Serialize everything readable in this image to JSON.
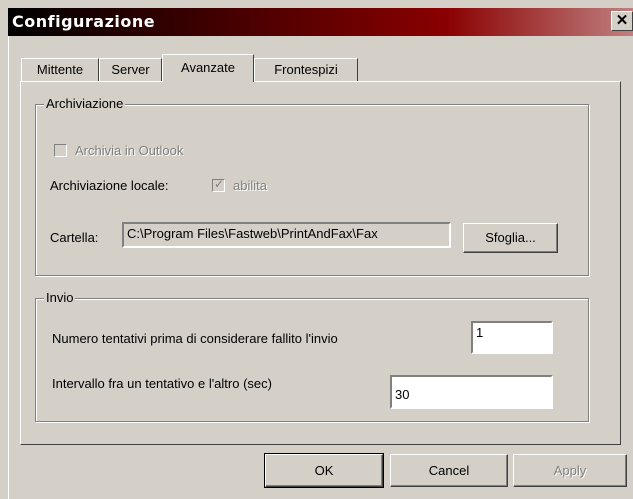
{
  "window": {
    "title": "Configurazione",
    "close_glyph": "✕"
  },
  "tabs": [
    {
      "label": "Mittente"
    },
    {
      "label": "Server"
    },
    {
      "label": "Avanzate",
      "selected": true
    },
    {
      "label": "Frontespizi"
    }
  ],
  "archiviazione": {
    "group_label": "Archiviazione",
    "outlook_label": "Archivia in Outlook",
    "outlook_checked": false,
    "locale_label": "Archiviazione locale:",
    "abilita_label": "abilita",
    "abilita_checked": true,
    "cartella_label": "Cartella:",
    "cartella_value": "C:\\Program Files\\Fastweb\\PrintAndFax\\Fax",
    "sfoglia_label": "Sfoglia..."
  },
  "invio": {
    "group_label": "Invio",
    "tentativi_label": "Numero tentativi prima di considerare fallito l'invio",
    "tentativi_value": "1",
    "intervallo_label": "Intervallo fra un tentativo e l'altro (sec)",
    "intervallo_value": "30"
  },
  "buttons": {
    "ok": "OK",
    "cancel": "Cancel",
    "apply": "Apply"
  }
}
